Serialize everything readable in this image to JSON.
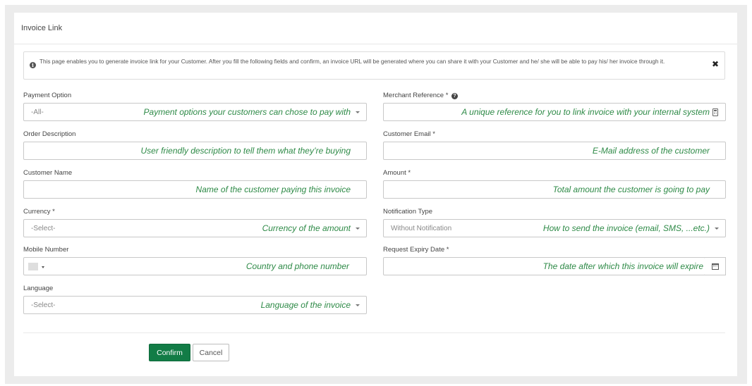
{
  "page": {
    "title": "Invoice Link"
  },
  "info": {
    "text": "This page enables you to generate invoice link for your Customer. After you fill the following fields and confirm, an invoice URL will be generated where you can share it with your Customer and he/ she will be able to pay his/ her invoice through it.",
    "icon": "info-circle-icon",
    "close_icon": "close-icon",
    "close_glyph": "✖"
  },
  "form": {
    "payment_option": {
      "label": "Payment Option",
      "value": "-All-",
      "hint": "Payment options your customers can chose to pay with"
    },
    "merchant_reference": {
      "label": "Merchant Reference *",
      "help_glyph": "?",
      "hint": "A unique reference for you to link invoice with your internal system"
    },
    "order_description": {
      "label": "Order Description",
      "hint": "User friendly description to tell them what they’re buying"
    },
    "customer_email": {
      "label": "Customer Email *",
      "hint": "E-Mail address of the customer"
    },
    "customer_name": {
      "label": "Customer Name",
      "hint": "Name of the customer paying this invoice"
    },
    "amount": {
      "label": "Amount *",
      "hint": "Total amount the customer is going to pay"
    },
    "currency": {
      "label": "Currency *",
      "value": "-Select-",
      "hint": "Currency of the amount"
    },
    "notification_type": {
      "label": "Notification Type",
      "value": "Without Notification",
      "hint": "How to send the invoice (email, SMS, ...etc.)"
    },
    "mobile_number": {
      "label": "Mobile Number",
      "hint": "Country and phone number"
    },
    "request_expiry_date": {
      "label": "Request Expiry Date *",
      "hint": "The date after which this invoice will expire"
    },
    "language": {
      "label": "Language",
      "value": "-Select-",
      "hint": "Language of the invoice"
    }
  },
  "actions": {
    "confirm": "Confirm",
    "cancel": "Cancel"
  },
  "colors": {
    "accent": "#127c46",
    "hint_text": "#2e8a47"
  }
}
